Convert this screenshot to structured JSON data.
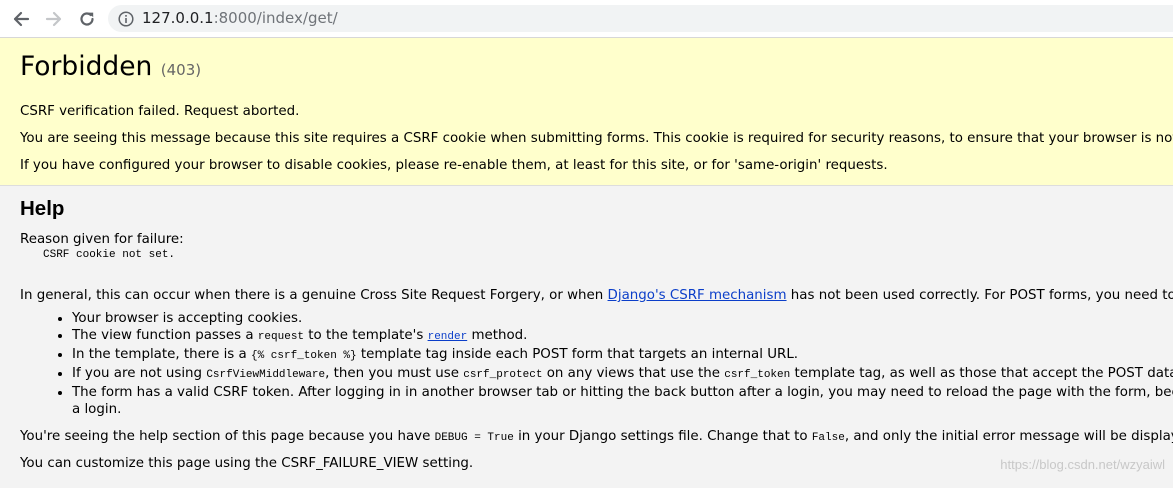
{
  "browser": {
    "url_host": "127.0.0.1",
    "url_rest": ":8000/index/get/"
  },
  "summary": {
    "title": "Forbidden",
    "status_code": "(403)",
    "message": "CSRF verification failed. Request aborted.",
    "explanation": "You are seeing this message because this site requires a CSRF cookie when submitting forms. This cookie is required for security reasons, to ensure that your browser is not being hijacked by third parties.",
    "cookies_hint": "If you have configured your browser to disable cookies, please re-enable them, at least for this site, or for 'same-origin' requests."
  },
  "help": {
    "heading": "Help",
    "reason_label": "Reason given for failure:",
    "reason_value": "CSRF cookie not set.",
    "general_before": "In general, this can occur when there is a genuine Cross Site Request Forgery, or when ",
    "django_link": "Django's CSRF mechanism",
    "general_after": " has not been used correctly. For POST forms, you need to ensure:",
    "bullets": {
      "b1": "Your browser is accepting cookies.",
      "b2_a": "The view function passes a ",
      "b2_code": "request",
      "b2_b": " to the template's ",
      "b2_link": "render",
      "b2_c": " method.",
      "b3_a": "In the template, there is a ",
      "b3_code": "{% csrf_token %}",
      "b3_b": " template tag inside each POST form that targets an internal URL.",
      "b4_a": "If you are not using ",
      "b4_code1": "CsrfViewMiddleware",
      "b4_b": ", then you must use ",
      "b4_code2": "csrf_protect",
      "b4_c": " on any views that use the ",
      "b4_code3": "csrf_token",
      "b4_d": " template tag, as well as those that accept the POST data.",
      "b5_line1": "The form has a valid CSRF token. After logging in in another browser tab or hitting the back button after a login, you may need to reload the page with the form, because the token is rotated after",
      "b5_line2": "a login."
    },
    "debug_a": "You're seeing the help section of this page because you have ",
    "debug_code1": "DEBUG = True",
    "debug_b": " in your Django settings file. Change that to ",
    "debug_code2": "False",
    "debug_c": ", and only the initial error message will be displayed.",
    "customize": "You can customize this page using the CSRF_FAILURE_VIEW setting."
  },
  "watermark": "https://blog.csdn.net/wzyaiwl"
}
